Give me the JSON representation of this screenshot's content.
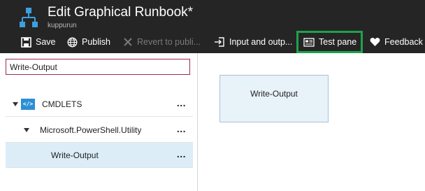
{
  "header": {
    "title": "Edit Graphical Runbook*",
    "subtitle": "kuppurun"
  },
  "toolbar": {
    "save": "Save",
    "publish": "Publish",
    "revert": "Revert to publi...",
    "input_output": "Input and outp...",
    "test_pane": "Test pane",
    "feedback": "Feedback",
    "highlight_color": "#1fa24a"
  },
  "library": {
    "search_value": "Write-Output",
    "tree": [
      {
        "label": "CMDLETS",
        "icon": "cmdlet-icon",
        "more": "..."
      },
      {
        "label": "Microsoft.PowerShell.Utility",
        "more": "..."
      },
      {
        "label": "Write-Output",
        "more": "..."
      }
    ]
  },
  "canvas": {
    "activity_label": "Write-Output"
  }
}
